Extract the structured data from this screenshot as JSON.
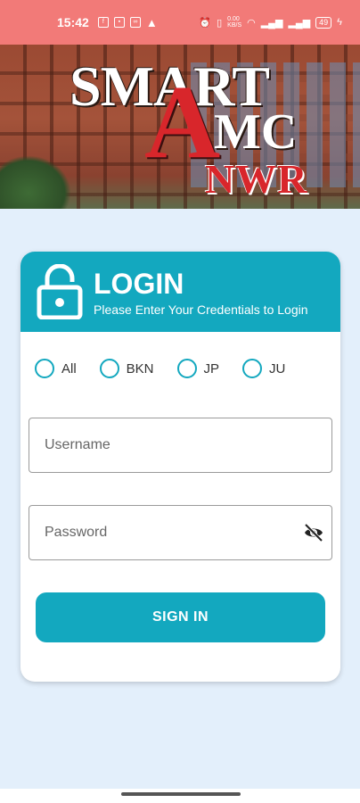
{
  "status_bar": {
    "time": "15:42",
    "network_speed": "0.00\nKB/S",
    "battery": "49"
  },
  "header": {
    "logo": {
      "line1": "SMART",
      "big_letter": "A",
      "line2": "MC",
      "line3": "NWR"
    }
  },
  "login": {
    "title": "LOGIN",
    "subtitle": "Please Enter Your Credentials to Login",
    "radio_options": [
      "All",
      "BKN",
      "JP",
      "JU"
    ],
    "username": {
      "placeholder": "Username",
      "value": ""
    },
    "password": {
      "placeholder": "Password",
      "value": ""
    },
    "signin_label": "SIGN IN"
  },
  "colors": {
    "accent": "#13a8bf",
    "status_bar": "#f27a78",
    "background": "#e3effb",
    "logo_red": "#d8262b"
  }
}
